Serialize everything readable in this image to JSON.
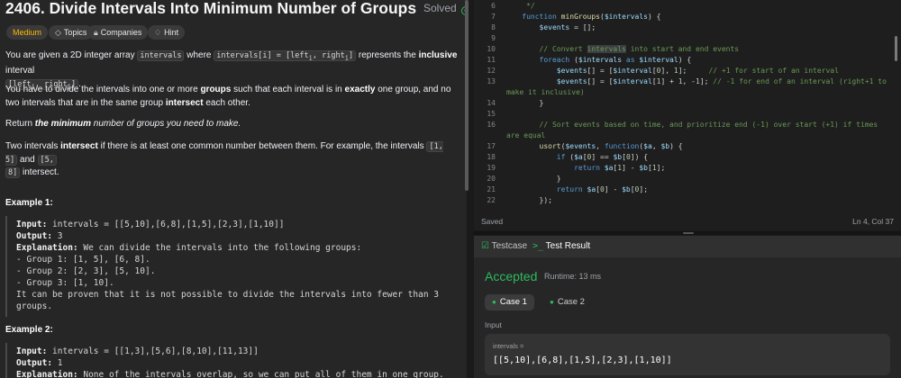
{
  "problem": {
    "title": "2406. Divide Intervals Into Minimum Number of Groups",
    "solved_label": "Solved",
    "difficulty": "Medium",
    "chips": {
      "topics": "Topics",
      "companies": "Companies",
      "hint": "Hint"
    },
    "p1": {
      "a": "You are given a 2D integer array ",
      "code1": "intervals",
      "b": " where ",
      "code2": "intervals[i] = [left",
      "code2_sub": "i",
      "code2_b": ", right",
      "code2_sub2": "i",
      "code2_c": "]",
      "c": " represents the ",
      "bold": "inclusive",
      "d": " interval",
      "code3": "[left",
      "code3_sub": "i",
      "code3_b": ", right",
      "code3_sub2": "i",
      "code3_c": "]",
      "e": "."
    },
    "p2": {
      "a": "You have to divide the intervals into one or more ",
      "bold1": "groups",
      "b": " such that each interval is in ",
      "bold2": "exactly",
      "c": " one group, and no two intervals that are in the same group ",
      "bold3": "intersect",
      "d": " each other."
    },
    "p3": {
      "a": "Return ",
      "bold": "the minimum",
      "b": " number of groups you need to make."
    },
    "p4": {
      "a": "Two intervals ",
      "bold": "intersect",
      "b": " if there is at least one common number between them. For example, the intervals ",
      "code1": "[1, 5]",
      "c": " and ",
      "code2": "[5,",
      "code3": "8]",
      "d": " intersect."
    },
    "example1": {
      "title": "Example 1:",
      "input_label": "Input:",
      "input": " intervals = [[5,10],[6,8],[1,5],[2,3],[1,10]]",
      "output_label": "Output:",
      "output": " 3",
      "expl_label": "Explanation:",
      "expl": " We can divide the intervals into the following groups:",
      "l1": "- Group 1: [1, 5], [6, 8].",
      "l2": "- Group 2: [2, 3], [5, 10].",
      "l3": "- Group 3: [1, 10].",
      "l4": "It can be proven that it is not possible to divide the intervals into fewer than 3",
      "l5": "groups."
    },
    "example2": {
      "title": "Example 2:",
      "input_label": "Input:",
      "input": " intervals = [[1,3],[5,6],[8,10],[11,13]]",
      "output_label": "Output:",
      "output": " 1",
      "expl_label": "Explanation:",
      "expl": " None of the intervals overlap, so we can put all of them in one group."
    }
  },
  "editor": {
    "lines": [
      {
        "n": "6",
        "tokens": [
          [
            "cm",
            "     */"
          ]
        ]
      },
      {
        "n": "7",
        "tokens": [
          [
            "kw",
            "    function "
          ],
          [
            "fn",
            "minGroups"
          ],
          [
            "pl",
            "("
          ],
          [
            "var",
            "$intervals"
          ],
          [
            "pl",
            ") {"
          ]
        ]
      },
      {
        "n": "8",
        "tokens": [
          [
            "var",
            "        $events"
          ],
          [
            "pl",
            " = [];"
          ]
        ]
      },
      {
        "n": "9",
        "tokens": []
      },
      {
        "n": "10",
        "tokens": [
          [
            "cm",
            "        // Convert "
          ],
          [
            "hl",
            "intervals"
          ],
          [
            "cm",
            " into start and end events"
          ]
        ]
      },
      {
        "n": "11",
        "tokens": [
          [
            "kw",
            "        foreach "
          ],
          [
            "pl",
            "("
          ],
          [
            "var",
            "$intervals"
          ],
          [
            "kw",
            " as "
          ],
          [
            "var",
            "$interval"
          ],
          [
            "pl",
            ") {"
          ]
        ]
      },
      {
        "n": "12",
        "tokens": [
          [
            "var",
            "            $events"
          ],
          [
            "pl",
            "[] = ["
          ],
          [
            "var",
            "$interval"
          ],
          [
            "pl",
            "["
          ],
          [
            "num",
            "0"
          ],
          [
            "pl",
            "], "
          ],
          [
            "num",
            "1"
          ],
          [
            "pl",
            "];     "
          ],
          [
            "cm",
            "// +1 for start of an interval"
          ]
        ]
      },
      {
        "n": "13",
        "tokens": [
          [
            "var",
            "            $events"
          ],
          [
            "pl",
            "[] = ["
          ],
          [
            "var",
            "$interval"
          ],
          [
            "pl",
            "["
          ],
          [
            "num",
            "1"
          ],
          [
            "pl",
            "] + "
          ],
          [
            "num",
            "1"
          ],
          [
            "pl",
            ", -"
          ],
          [
            "num",
            "1"
          ],
          [
            "pl",
            "]; "
          ],
          [
            "cm",
            "// -1 for end of an interval (right+1 to"
          ]
        ]
      },
      {
        "n": "",
        "tokens": [
          [
            "cm",
            "make it inclusive)"
          ]
        ]
      },
      {
        "n": "14",
        "tokens": [
          [
            "pl",
            "        }"
          ]
        ]
      },
      {
        "n": "15",
        "tokens": []
      },
      {
        "n": "16",
        "tokens": [
          [
            "cm",
            "        // Sort events based on time, and prioritize end (-1) over start (+1) if times"
          ]
        ]
      },
      {
        "n": "",
        "tokens": [
          [
            "cm",
            "are equal"
          ]
        ]
      },
      {
        "n": "17",
        "tokens": [
          [
            "fn",
            "        usort"
          ],
          [
            "pl",
            "("
          ],
          [
            "var",
            "$events"
          ],
          [
            "pl",
            ", "
          ],
          [
            "kw",
            "function"
          ],
          [
            "pl",
            "("
          ],
          [
            "var",
            "$a"
          ],
          [
            "pl",
            ", "
          ],
          [
            "var",
            "$b"
          ],
          [
            "pl",
            ") {"
          ]
        ]
      },
      {
        "n": "18",
        "tokens": [
          [
            "kw",
            "            if "
          ],
          [
            "pl",
            "("
          ],
          [
            "var",
            "$a"
          ],
          [
            "pl",
            "["
          ],
          [
            "num",
            "0"
          ],
          [
            "pl",
            "] == "
          ],
          [
            "var",
            "$b"
          ],
          [
            "pl",
            "["
          ],
          [
            "num",
            "0"
          ],
          [
            "pl",
            "]) {"
          ]
        ]
      },
      {
        "n": "19",
        "tokens": [
          [
            "kw",
            "                return "
          ],
          [
            "var",
            "$a"
          ],
          [
            "pl",
            "["
          ],
          [
            "num",
            "1"
          ],
          [
            "pl",
            "] - "
          ],
          [
            "var",
            "$b"
          ],
          [
            "pl",
            "["
          ],
          [
            "num",
            "1"
          ],
          [
            "pl",
            "];"
          ]
        ]
      },
      {
        "n": "20",
        "tokens": [
          [
            "pl",
            "            }"
          ]
        ]
      },
      {
        "n": "21",
        "tokens": [
          [
            "kw",
            "            return "
          ],
          [
            "var",
            "$a"
          ],
          [
            "pl",
            "["
          ],
          [
            "num",
            "0"
          ],
          [
            "pl",
            "] - "
          ],
          [
            "var",
            "$b"
          ],
          [
            "pl",
            "["
          ],
          [
            "num",
            "0"
          ],
          [
            "pl",
            "];"
          ]
        ]
      },
      {
        "n": "22",
        "tokens": [
          [
            "pl",
            "        });"
          ]
        ]
      }
    ],
    "status_left": "Saved",
    "status_right": "Ln 4, Col 37"
  },
  "results": {
    "tab_testcase": "Testcase",
    "tab_result": "Test Result",
    "status": "Accepted",
    "runtime": "Runtime: 13 ms",
    "case1": "Case 1",
    "case2": "Case 2",
    "input_label": "Input",
    "var_name": "intervals =",
    "var_value": "[[5,10],[6,8],[1,5],[2,3],[1,10]]"
  },
  "colors": {
    "accent_green": "#2cbb5d",
    "medium": "#ffb800"
  },
  "icons": [
    "check-circle-icon",
    "tag-icon",
    "lock-icon",
    "bulb-icon",
    "testcase-icon",
    "terminal-icon"
  ]
}
